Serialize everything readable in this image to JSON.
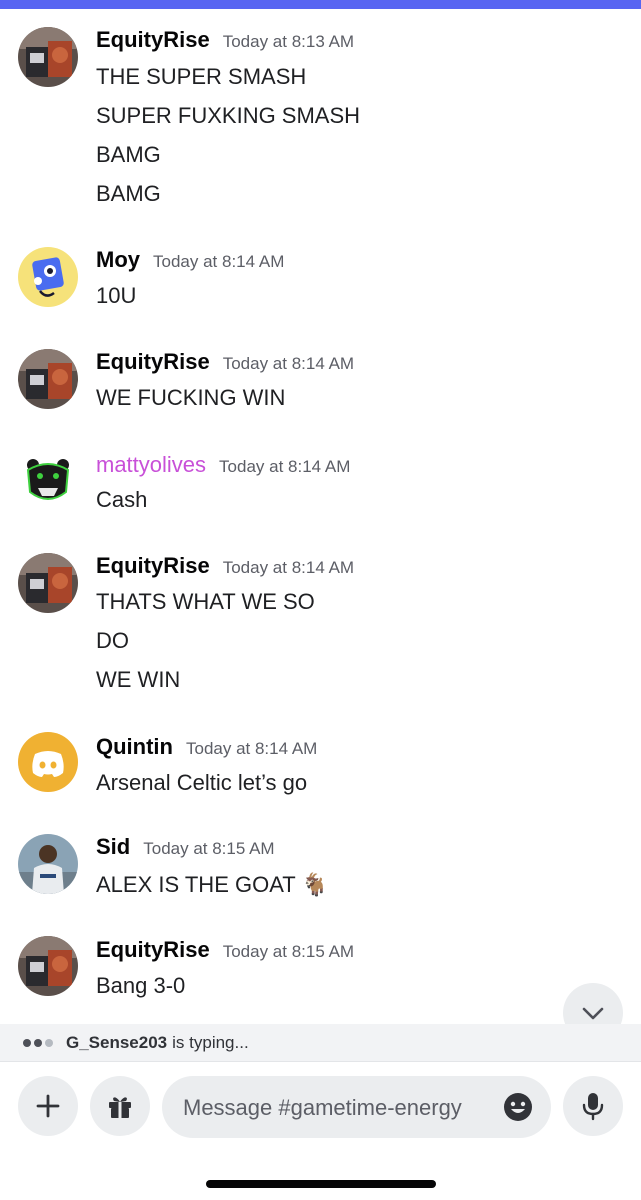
{
  "channel": {
    "input_placeholder": "Message #gametime-energy"
  },
  "messages": [
    {
      "author": "EquityRise",
      "timestamp": "Today at 8:13 AM",
      "lines": [
        "THE SUPER SMASH",
        "SUPER FUXKING SMASH",
        "BAMG",
        "BAMG"
      ]
    },
    {
      "author": "Moy",
      "timestamp": "Today at 8:14 AM",
      "lines": [
        "10U"
      ]
    },
    {
      "author": "EquityRise",
      "timestamp": "Today at 8:14 AM",
      "lines": [
        "WE FUCKING WIN"
      ]
    },
    {
      "author": "mattyolives",
      "author_color": "#c850d8",
      "timestamp": "Today at 8:14 AM",
      "lines": [
        "Cash"
      ]
    },
    {
      "author": "EquityRise",
      "timestamp": "Today at 8:14 AM",
      "lines": [
        "THATS WHAT WE SO",
        "DO",
        "WE WIN"
      ]
    },
    {
      "author": "Quintin",
      "timestamp": "Today at 8:14 AM",
      "lines": [
        "Arsenal Celtic let’s go"
      ]
    },
    {
      "author": "Sid",
      "timestamp": "Today at 8:15 AM",
      "lines": [
        "ALEX IS THE GOAT 🐐"
      ]
    },
    {
      "author": "EquityRise",
      "timestamp": "Today at 8:15 AM",
      "lines": [
        "Bang 3-0"
      ]
    }
  ],
  "typing": {
    "user": "G_Sense203",
    "text": "is typing..."
  },
  "icons": {
    "avatars": [
      "equityrise-avatar",
      "moy-avatar",
      "mattyolives-avatar",
      "quintin-discord-avatar",
      "sid-avatar"
    ],
    "composer": [
      "plus-icon",
      "gift-icon",
      "emoji-icon",
      "microphone-icon"
    ],
    "scroll": "chevron-down-icon"
  },
  "colors": {
    "accent": "#5865f2",
    "mattyolives": "#c850d8",
    "quintin_avatar": "#f0b132"
  }
}
